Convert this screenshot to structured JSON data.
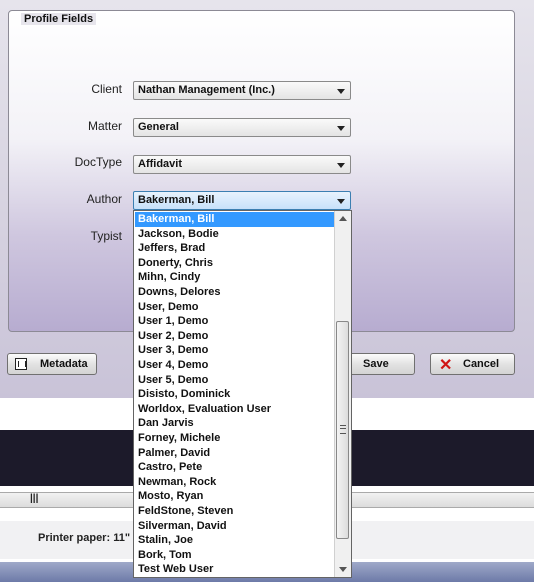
{
  "panel": {
    "title": "Profile Fields"
  },
  "fields": [
    {
      "label": "Client",
      "value": "Nathan Management (Inc.)"
    },
    {
      "label": "Matter",
      "value": "General"
    },
    {
      "label": "DocType",
      "value": "Affidavit"
    },
    {
      "label": "Author",
      "value": "Bakerman, Bill"
    },
    {
      "label": "Typist",
      "value": ""
    }
  ],
  "buttons": {
    "metadata": "Metadata",
    "save": "Save",
    "cancel": "Cancel"
  },
  "author_dropdown": {
    "selected_index": 0,
    "options": [
      "Bakerman, Bill",
      "Jackson, Bodie",
      "Jeffers, Brad",
      "Donerty, Chris",
      "Mihn, Cindy",
      "Downs, Delores",
      "User, Demo",
      "User 1, Demo",
      "User 2, Demo",
      "User 3, Demo",
      "User 4, Demo",
      "User 5, Demo",
      "Disisto, Dominick",
      "Worldox, Evaluation User",
      "Dan Jarvis",
      "Forney, Michele",
      "Palmer, David",
      "Castro, Pete",
      "Newman, Rock",
      "Mosto, Ryan",
      "FeldStone, Steven",
      "Silverman, David",
      "Stalin, Joe",
      "Bork, Tom",
      "Test Web User"
    ]
  },
  "background": {
    "grip": "|||",
    "printer_label": "Printer paper:",
    "printer_value": "11\""
  }
}
